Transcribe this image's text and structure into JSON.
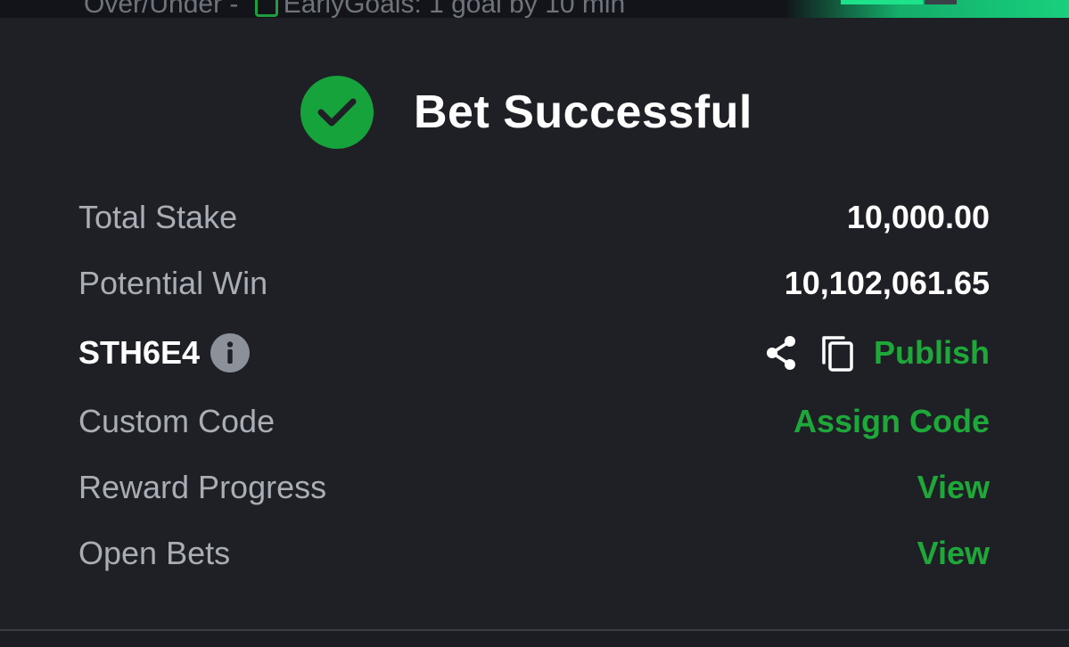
{
  "background_header": {
    "text": "Over/Under - ",
    "text2": "EarlyGoals: 1 goal by 10 min"
  },
  "header": {
    "title": "Bet Successful",
    "status_color": "#17a33b"
  },
  "rows": {
    "total_stake": {
      "label": "Total Stake",
      "value": "10,000.00"
    },
    "potential_win": {
      "label": "Potential Win",
      "value": "10,102,061.65"
    },
    "booking_code": {
      "code": "STH6E4",
      "action": "Publish"
    },
    "custom_code": {
      "label": "Custom Code",
      "action": "Assign Code"
    },
    "reward_progress": {
      "label": "Reward Progress",
      "action": "View"
    },
    "open_bets": {
      "label": "Open Bets",
      "action": "View"
    }
  },
  "icons": [
    "check-circle-icon",
    "info-icon",
    "share-icon",
    "copy-icon"
  ],
  "colors": {
    "accent_green": "#1fa83a",
    "background": "#1e2026",
    "muted_text": "#a9adb4"
  }
}
